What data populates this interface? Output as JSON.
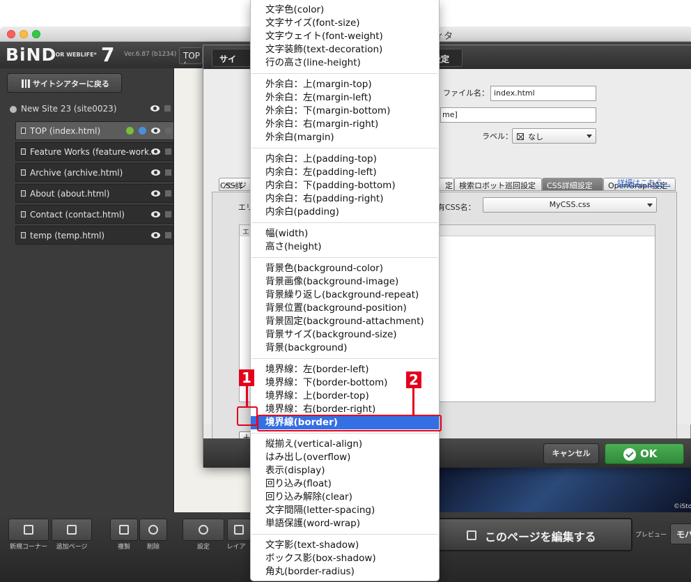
{
  "window": {
    "title": "サイトエディタ"
  },
  "app": {
    "logo": "BiND",
    "logo_sub": "FOR WEBLIFE*",
    "logo_version_number": "7",
    "version": "Ver.6.87 (b1234)",
    "top_tab": "TOP ("
  },
  "sidebar": {
    "back_button": "サイトシアターに戻る",
    "site": "New Site 23 (site0023)",
    "pages": [
      {
        "label": "TOP (index.html)"
      },
      {
        "label": "Feature Works (feature-work..."
      },
      {
        "label": "Archive (archive.html)"
      },
      {
        "label": "About (about.html)"
      },
      {
        "label": "Contact (contact.html)"
      },
      {
        "label": "temp (temp.html)"
      }
    ]
  },
  "dialog": {
    "tabs": [
      "サイ",
      "設定"
    ],
    "file_name_label": "ファイル名：",
    "file_name_value": "index.html",
    "second_field_value": "me]",
    "label_label": "ラベル：",
    "label_value": "なし",
    "content_tabs": [
      "ページ",
      "定",
      "検索ロボット巡回設定",
      "CSS詳細設定",
      "OpenGraph設定"
    ],
    "panel_heading": "CSS詳",
    "detail_link": "詳細はこちら...",
    "element_label": "エリ",
    "shared_css_label": "有CSS名：",
    "shared_css_value": "MyCSS.css",
    "element_area_header": "エ",
    "add_button": "+",
    "cancel": "キャンセル",
    "ok": "OK"
  },
  "menu": {
    "groups": [
      [
        "文字色(color)",
        "文字サイズ(font-size)",
        "文字ウェイト(font-weight)",
        "文字装飾(text-decoration)",
        "行の高さ(line-height)"
      ],
      [
        "外余白：上(margin-top)",
        "外余白：左(margin-left)",
        "外余白：下(margin-bottom)",
        "外余白：右(margin-right)",
        "外余白(margin)"
      ],
      [
        "内余白：上(padding-top)",
        "内余白：左(padding-left)",
        "内余白：下(padding-bottom)",
        "内余白：右(padding-right)",
        "内余白(padding)"
      ],
      [
        "幅(width)",
        "高さ(height)"
      ],
      [
        "背景色(background-color)",
        "背景画像(background-image)",
        "背景繰り返し(background-repeat)",
        "背景位置(background-position)",
        "背景固定(background-attachment)",
        "背景サイズ(background-size)",
        "背景(background)"
      ],
      [
        "境界線：左(border-left)",
        "境界線：下(border-bottom)",
        "境界線：上(border-top)",
        "境界線：右(border-right)",
        "境界線(border)"
      ],
      [
        "縦揃え(vertical-align)",
        "はみ出し(overflow)",
        "表示(display)",
        "回り込み(float)",
        "回り込み解除(clear)",
        "文字間隔(letter-spacing)",
        "単語保護(word-wrap)"
      ],
      [
        "文字影(text-shadow)",
        "ボックス影(box-shadow)",
        "角丸(border-radius)"
      ]
    ],
    "highlighted": "境界線(border)"
  },
  "callouts": [
    "1",
    "2"
  ],
  "bottom_bar": {
    "new_corner": "新規コーナー",
    "add_page": "追加ページ",
    "duplicate": "複製",
    "delete": "削除",
    "settings": "設定",
    "layout": "レイア",
    "edit_page": "このページを編集する",
    "preview": "プレビュー",
    "mobile": "モバ"
  },
  "photo_credit": "©iSto",
  "colors": {
    "accent_red": "#e4001b",
    "highlight_blue": "#3470e3",
    "ok_green": "#3a9a44"
  }
}
